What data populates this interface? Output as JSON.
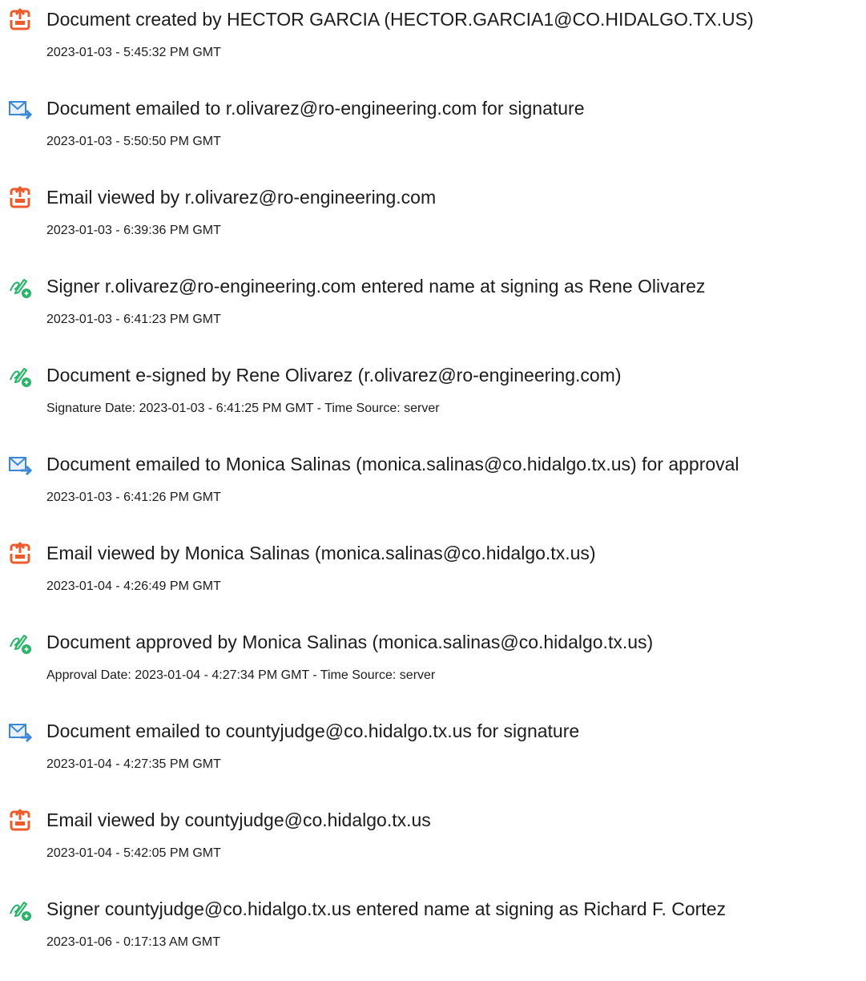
{
  "events": [
    {
      "icon": "document-created-icon",
      "title": "Document created by HECTOR GARCIA (HECTOR.GARCIA1@CO.HIDALGO.TX.US)",
      "subtitle": "2023-01-03 - 5:45:32 PM GMT"
    },
    {
      "icon": "email-sent-icon",
      "title": "Document emailed to r.olivarez@ro-engineering.com for signature",
      "subtitle": "2023-01-03 - 5:50:50 PM GMT"
    },
    {
      "icon": "document-created-icon",
      "title": "Email viewed by r.olivarez@ro-engineering.com",
      "subtitle": "2023-01-03 - 6:39:36 PM GMT"
    },
    {
      "icon": "signature-pen-icon",
      "title": "Signer r.olivarez@ro-engineering.com entered name at signing as Rene Olivarez",
      "subtitle": "2023-01-03 - 6:41:23 PM GMT"
    },
    {
      "icon": "signature-pen-icon",
      "title": "Document e-signed by Rene Olivarez (r.olivarez@ro-engineering.com)",
      "subtitle": "Signature Date: 2023-01-03 - 6:41:25 PM GMT - Time Source: server"
    },
    {
      "icon": "email-sent-icon",
      "title": "Document emailed to Monica Salinas (monica.salinas@co.hidalgo.tx.us) for approval",
      "subtitle": "2023-01-03 - 6:41:26 PM GMT"
    },
    {
      "icon": "document-created-icon",
      "title": "Email viewed by Monica Salinas (monica.salinas@co.hidalgo.tx.us)",
      "subtitle": "2023-01-04 - 4:26:49 PM GMT"
    },
    {
      "icon": "signature-pen-icon",
      "title": "Document approved by Monica Salinas (monica.salinas@co.hidalgo.tx.us)",
      "subtitle": "Approval Date: 2023-01-04 - 4:27:34 PM GMT - Time Source: server"
    },
    {
      "icon": "email-sent-icon",
      "title": "Document emailed to countyjudge@co.hidalgo.tx.us for signature",
      "subtitle": "2023-01-04 - 4:27:35 PM GMT"
    },
    {
      "icon": "document-created-icon",
      "title": "Email viewed by countyjudge@co.hidalgo.tx.us",
      "subtitle": "2023-01-04 - 5:42:05 PM GMT"
    },
    {
      "icon": "signature-pen-icon",
      "title": "Signer countyjudge@co.hidalgo.tx.us entered name at signing as Richard F. Cortez",
      "subtitle": "2023-01-06 - 0:17:13 AM GMT"
    }
  ],
  "colors": {
    "document_icon": "#ee5b2b",
    "email_icon": "#3d88d6",
    "signature_icon": "#2bb36b"
  }
}
